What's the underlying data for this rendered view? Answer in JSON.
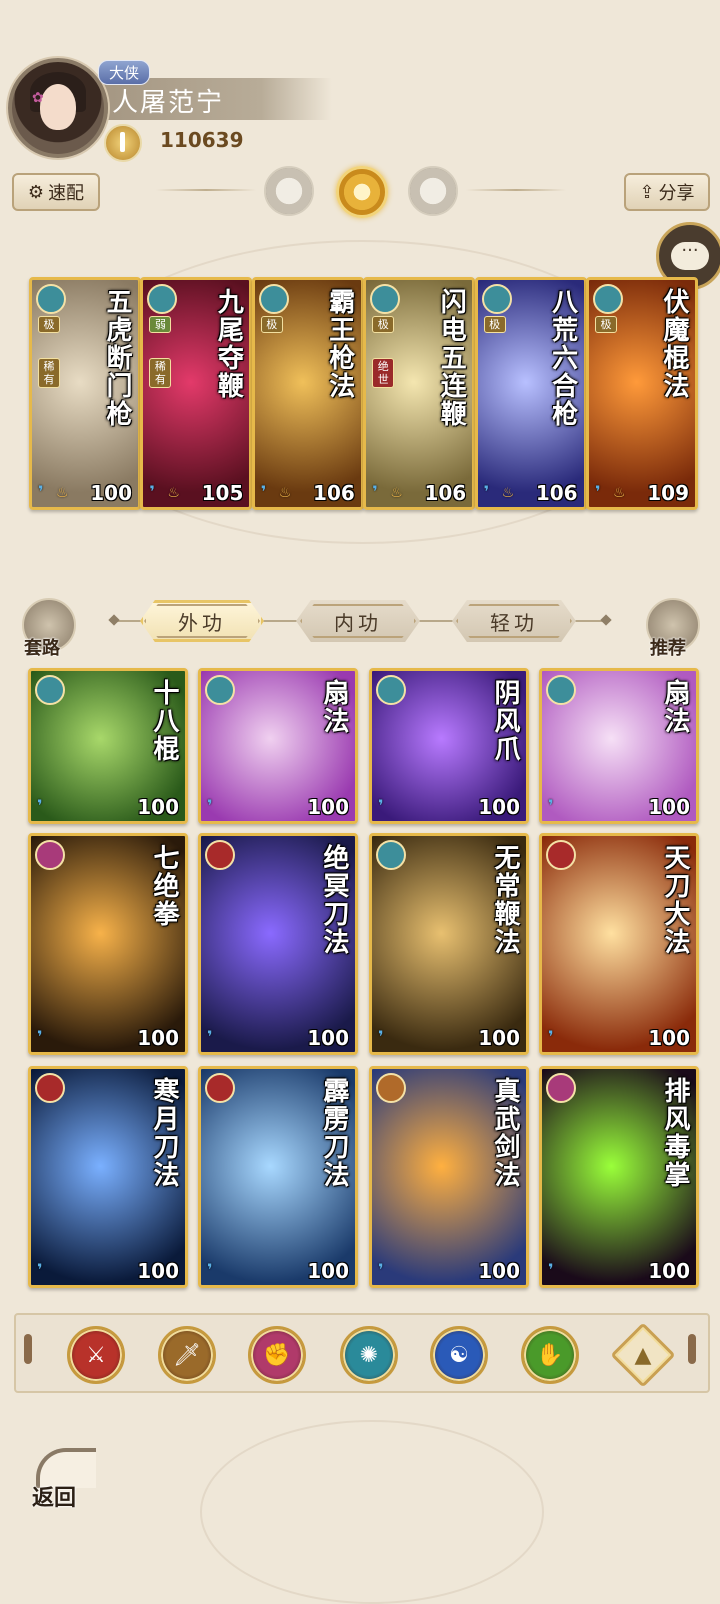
{
  "player": {
    "rank_badge": "大侠",
    "name": "人屠范宁",
    "power": "110639"
  },
  "toolbar": {
    "quick_label": "速配",
    "share_label": "分享"
  },
  "equipped": [
    {
      "title": "五虎断门枪",
      "badges": [
        "极",
        "稀有"
      ],
      "level": "100",
      "element_color": "#3d8e9a",
      "art": [
        "#e8dcc4",
        "#8a7a62"
      ]
    },
    {
      "title": "九尾夺鞭",
      "badges": [
        "弱",
        "稀有"
      ],
      "level": "105",
      "element_color": "#3d8e9a",
      "art": [
        "#e33a6a",
        "#5a1020"
      ]
    },
    {
      "title": "霸王枪法",
      "badges": [
        "极"
      ],
      "level": "106",
      "element_color": "#3d8e9a",
      "art": [
        "#f0c05a",
        "#6a3a10"
      ]
    },
    {
      "title": "闪电五连鞭",
      "badges": [
        "极",
        "绝世"
      ],
      "level": "106",
      "element_color": "#3d8e9a",
      "art": [
        "#f4e6b0",
        "#7a6a3a"
      ]
    },
    {
      "title": "八荒六合枪",
      "badges": [
        "极"
      ],
      "level": "106",
      "element_color": "#3d8e9a",
      "art": [
        "#b8c0ff",
        "#2a2a7a"
      ]
    },
    {
      "title": "伏魔棍法",
      "badges": [
        "极"
      ],
      "level": "109",
      "element_color": "#3d8e9a",
      "art": [
        "#ff9a3a",
        "#7a2a0a"
      ]
    }
  ],
  "tabs": {
    "left_label": "套路",
    "right_label": "推荐",
    "items": [
      "外功",
      "内功",
      "轻功"
    ],
    "active_index": 0
  },
  "skills": [
    {
      "title": "十八棍",
      "level": "100",
      "element_color": "#3d8e9a",
      "art": [
        "#a8d86a",
        "#2a5a1a"
      ]
    },
    {
      "title": "扇法",
      "level": "100",
      "element_color": "#3d8e9a",
      "art": [
        "#f0d0f0",
        "#9a3ab0"
      ]
    },
    {
      "title": "阴风爪",
      "level": "100",
      "element_color": "#3d8e9a",
      "art": [
        "#b87aff",
        "#3a1a7a"
      ]
    },
    {
      "title": "扇法",
      "level": "100",
      "element_color": "#3d8e9a",
      "art": [
        "#f6e0f6",
        "#b05ac0"
      ]
    },
    {
      "title": "七绝拳",
      "level": "100",
      "element_color": "#a83a7a",
      "art": [
        "#f7b24a",
        "#2a1a0a"
      ]
    },
    {
      "title": "绝冥刀法",
      "level": "100",
      "element_color": "#a82a2a",
      "art": [
        "#8a6aff",
        "#1a1a4a"
      ]
    },
    {
      "title": "无常鞭法",
      "level": "100",
      "element_color": "#3d8e9a",
      "art": [
        "#e8c070",
        "#3a2a10"
      ]
    },
    {
      "title": "天刀大法",
      "level": "100",
      "element_color": "#a82a2a",
      "art": [
        "#ffe0a0",
        "#8a2a0a"
      ]
    },
    {
      "title": "寒月刀法",
      "level": "100",
      "element_color": "#a82a2a",
      "art": [
        "#7ab0ff",
        "#0a1a3a"
      ]
    },
    {
      "title": "霹雳刀法",
      "level": "100",
      "element_color": "#a82a2a",
      "art": [
        "#a8d8ff",
        "#1a3a6a"
      ]
    },
    {
      "title": "真武剑法",
      "level": "100",
      "element_color": "#b06a2a",
      "art": [
        "#ffb040",
        "#2a3a7a"
      ]
    },
    {
      "title": "排风毒掌",
      "level": "100",
      "element_color": "#a83a7a",
      "art": [
        "#9aff3a",
        "#1a0a1a"
      ]
    }
  ],
  "filters": [
    {
      "icon": "sword-element-icon",
      "glyph": "⚔",
      "color": "#b8322a"
    },
    {
      "icon": "blade-element-icon",
      "glyph": "🗡",
      "color": "#9a6a2a"
    },
    {
      "icon": "fist-element-icon",
      "glyph": "✊",
      "color": "#b03a6a"
    },
    {
      "icon": "fan-element-icon",
      "glyph": "✺",
      "color": "#2a8a9a"
    },
    {
      "icon": "taiji-element-icon",
      "glyph": "☯",
      "color": "#2a5ab8"
    },
    {
      "icon": "palm-element-icon",
      "glyph": "✋",
      "color": "#4a9a2a"
    },
    {
      "icon": "up-arrow-icon",
      "glyph": "▲",
      "color": "#f1e4c4"
    }
  ],
  "back_label": "返回"
}
